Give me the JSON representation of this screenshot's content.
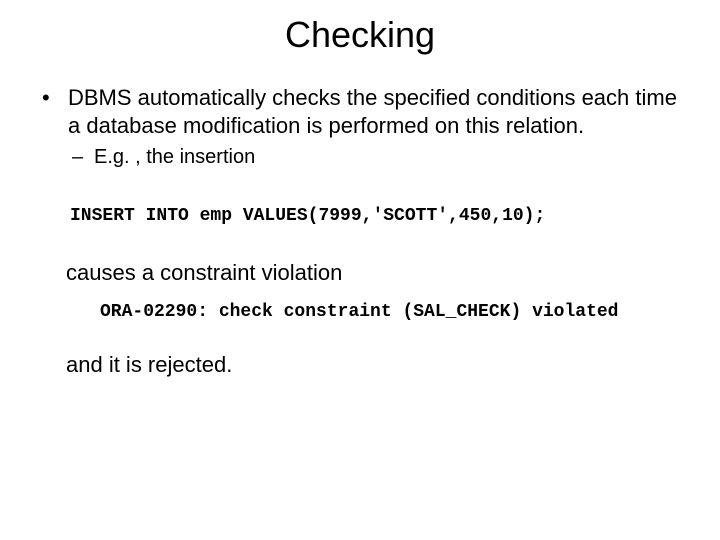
{
  "title": "Checking",
  "bullet": "DBMS automatically checks the specified conditions each time a database modification is performed on this relation.",
  "sub": "E.g. , the insertion",
  "code1": "INSERT INTO emp VALUES(7999,'SCOTT',450,10);",
  "line1": "causes a constraint violation",
  "err": "ORA-02290: check constraint (SAL_CHECK) violated",
  "line2": "and it is rejected."
}
